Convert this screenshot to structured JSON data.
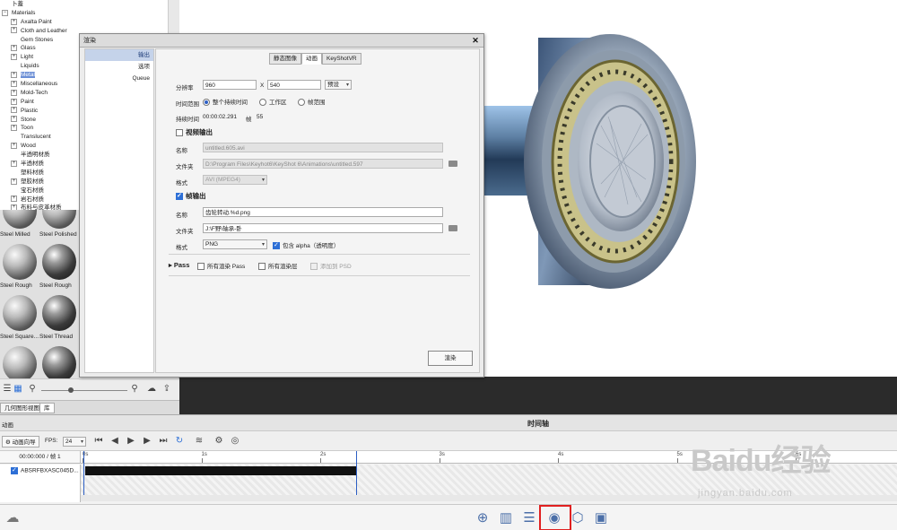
{
  "tree": {
    "items": [
      {
        "label": "卜蓋",
        "expander": "",
        "indent": 0
      },
      {
        "label": "Materials",
        "expander": "−",
        "indent": 0
      },
      {
        "label": "Axalta Paint",
        "expander": "+",
        "indent": 1
      },
      {
        "label": "Cloth and Leather",
        "expander": "+",
        "indent": 1
      },
      {
        "label": "Gem Stones",
        "expander": "",
        "indent": 1
      },
      {
        "label": "Glass",
        "expander": "+",
        "indent": 1
      },
      {
        "label": "Light",
        "expander": "+",
        "indent": 1
      },
      {
        "label": "Liquids",
        "expander": "",
        "indent": 1
      },
      {
        "label": "Metal",
        "expander": "+",
        "indent": 1,
        "selected": true
      },
      {
        "label": "Miscellaneous",
        "expander": "+",
        "indent": 1
      },
      {
        "label": "Mold-Tech",
        "expander": "+",
        "indent": 1
      },
      {
        "label": "Paint",
        "expander": "+",
        "indent": 1
      },
      {
        "label": "Plastic",
        "expander": "+",
        "indent": 1
      },
      {
        "label": "Stone",
        "expander": "+",
        "indent": 1
      },
      {
        "label": "Toon",
        "expander": "+",
        "indent": 1
      },
      {
        "label": "Translucent",
        "expander": "",
        "indent": 1
      },
      {
        "label": "Wood",
        "expander": "+",
        "indent": 1
      },
      {
        "label": "半透明材质",
        "expander": "",
        "indent": 1
      },
      {
        "label": "半透材质",
        "expander": "+",
        "indent": 1
      },
      {
        "label": "塑料材质",
        "expander": "",
        "indent": 1
      },
      {
        "label": "塑胶材质",
        "expander": "+",
        "indent": 1
      },
      {
        "label": "宝石材质",
        "expander": "",
        "indent": 1
      },
      {
        "label": "岩石材质",
        "expander": "+",
        "indent": 1
      },
      {
        "label": "布料与皮革材质",
        "expander": "+",
        "indent": 1
      }
    ]
  },
  "thumbnails": [
    {
      "caption": "Steel Milled",
      "style": "light"
    },
    {
      "caption": "Steel Polished",
      "style": "light"
    },
    {
      "caption": "Steel Rough",
      "style": "light"
    },
    {
      "caption": "Steel Rough",
      "style": "dark"
    },
    {
      "caption": "Steel Square...",
      "style": "light"
    },
    {
      "caption": "Steel Thread",
      "style": "dark"
    },
    {
      "caption": "",
      "style": "light"
    },
    {
      "caption": "",
      "style": "dark"
    }
  ],
  "left_tabs": [
    "几何图形视图",
    "库"
  ],
  "dialog": {
    "title": "渲染",
    "close": "✕",
    "nav": [
      "输出",
      "选项",
      "Queue"
    ],
    "tabs": [
      "静态图像",
      "动画",
      "KeyShotVR"
    ],
    "resolution_label": "分辨率",
    "width": "960",
    "x": "X",
    "height": "540",
    "preset": "预设",
    "time_range_label": "时间范围",
    "time_range_options": [
      "整个持续时间",
      "工作区",
      "帧范围"
    ],
    "duration_label": "持续时间",
    "duration_value": "00:00:02.291",
    "frames_label": "帧",
    "frames_value": "55",
    "video_output_label": "视频输出",
    "video_name_label": "名称",
    "video_name_value": "untitled.605.avi",
    "video_folder_label": "文件夹",
    "video_folder_value": "D:\\Program Files\\Keyhot6\\KeyShot 6\\Animations\\untitled.597",
    "video_format_label": "格式",
    "video_format_value": "AVI (MPEG4)",
    "frame_output_label": "帧输出",
    "frame_name_label": "名称",
    "frame_name_value": "齿轮转动.%d.png",
    "frame_folder_label": "文件夹",
    "frame_folder_value": "J:\\F野\\轴承-卧",
    "frame_format_label": "格式",
    "frame_format_value": "PNG",
    "alpha_label": "包含 alpha（透明度）",
    "pass_label": "Pass",
    "pass_options": [
      "所有渲染 Pass",
      "所有渲染层",
      "添加到 PSD"
    ],
    "render_button": "渲染"
  },
  "timeline": {
    "title": "时间轴",
    "left_header": "动画",
    "wizard_button": "动画向导",
    "fps_label": "FPS:",
    "fps_value": "24",
    "current_time": "00:00:000 / 帧 1",
    "track_name": "ABSRFBXASC045D...",
    "ticks": [
      "0s",
      "1s",
      "2s",
      "3s",
      "4s",
      "5s",
      "6s"
    ]
  },
  "watermark": {
    "logo": "Baidu经验",
    "url": "jingyan.baidu.com"
  },
  "colors": {
    "accent": "#2d6fd6",
    "selection": "#6c8fd6",
    "highlight": "#e02020"
  }
}
